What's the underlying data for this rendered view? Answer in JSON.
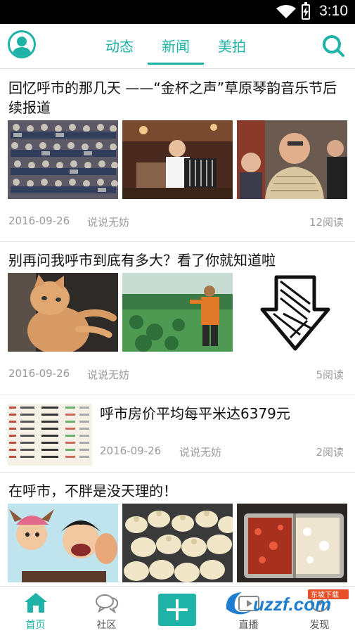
{
  "status": {
    "time": "3:10"
  },
  "header": {
    "tabs": [
      {
        "label": "动态"
      },
      {
        "label": "新闻"
      },
      {
        "label": "美拍"
      }
    ],
    "active_tab": "新闻"
  },
  "articles": [
    {
      "title": "回忆呼市的那几天 ——“金杯之声”草原琴韵音乐节后续报道",
      "date": "2016-09-26",
      "source": "说说无妨",
      "reads": "12阅读"
    },
    {
      "title": "别再问我呼市到底有多大？看了你就知道啦",
      "date": "2016-09-26",
      "source": "说说无妨",
      "reads": "5阅读"
    },
    {
      "title": "呼市房价平均每平米达6379元",
      "date": "2016-09-26",
      "source": "说说无妨",
      "reads": "2阅读"
    },
    {
      "title": "在呼市，不胖是没天理的！"
    }
  ],
  "bottom_nav": [
    {
      "label": "首页",
      "icon": "home-icon"
    },
    {
      "label": "社区",
      "icon": "chat-bubbles-icon"
    },
    {
      "label": "",
      "icon": "plus-icon"
    },
    {
      "label": "直播",
      "icon": "live-icon"
    },
    {
      "label": "发现",
      "icon": "discover-icon"
    }
  ],
  "watermark": {
    "text": "uzzf.com",
    "subtext": "东坡下载"
  },
  "colors": {
    "accent": "#1fb3a7"
  }
}
